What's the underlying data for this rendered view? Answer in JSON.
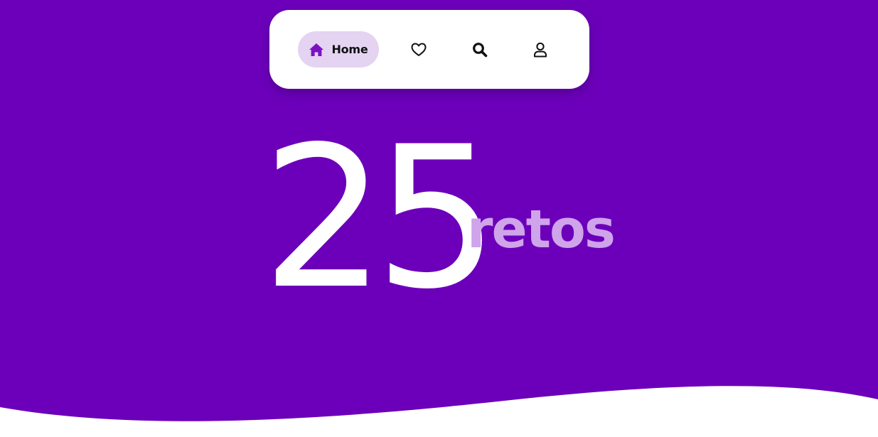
{
  "nav": {
    "items": [
      {
        "id": "home",
        "label": "Home",
        "icon": "home-icon",
        "active": true
      },
      {
        "id": "favorites",
        "label": "",
        "icon": "heart-icon",
        "active": false
      },
      {
        "id": "search",
        "label": "",
        "icon": "search-icon",
        "active": false
      },
      {
        "id": "profile",
        "label": "",
        "icon": "user-icon",
        "active": false
      }
    ]
  },
  "hero": {
    "count": "25",
    "unit": "retos"
  },
  "colors": {
    "background": "#6c00ba",
    "nav_card": "#ffffff",
    "active_pill": "#e5d3f2",
    "accent_icon": "#7a12c4",
    "number": "#ffffff",
    "unit": "#cfa4ea",
    "wave": "#ffffff"
  }
}
